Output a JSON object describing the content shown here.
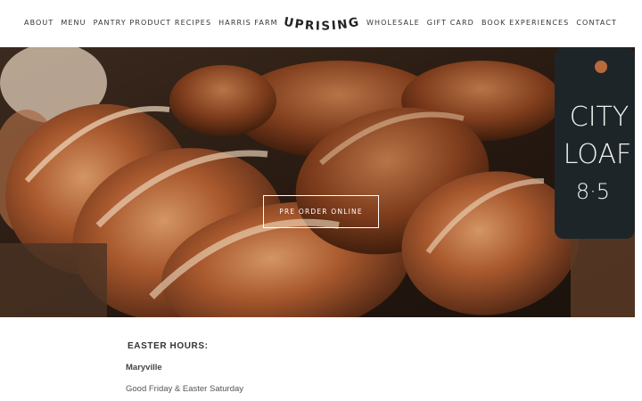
{
  "nav_left": [
    {
      "label": "About"
    },
    {
      "label": "Menu"
    },
    {
      "label": "Pantry Product Recipes"
    },
    {
      "label": "Harris Farm"
    }
  ],
  "nav_right": [
    {
      "label": "Wholesale"
    },
    {
      "label": "Gift Card"
    },
    {
      "label": "Book Experiences"
    },
    {
      "label": "Contact"
    }
  ],
  "logo": {
    "text": "UPRISING"
  },
  "hero": {
    "cta_label": "Pre Order Online",
    "sign": {
      "line1": "CITY",
      "line2": "LOAF",
      "line3": "8·5"
    }
  },
  "content": {
    "title": "EASTER HOURS:",
    "location": "Maryville",
    "hours": "Good Friday & Easter Saturday"
  },
  "colors": {
    "text": "#333333",
    "background": "#ffffff",
    "hero_dark": "#2a1c13",
    "bread": "#b0683a"
  }
}
